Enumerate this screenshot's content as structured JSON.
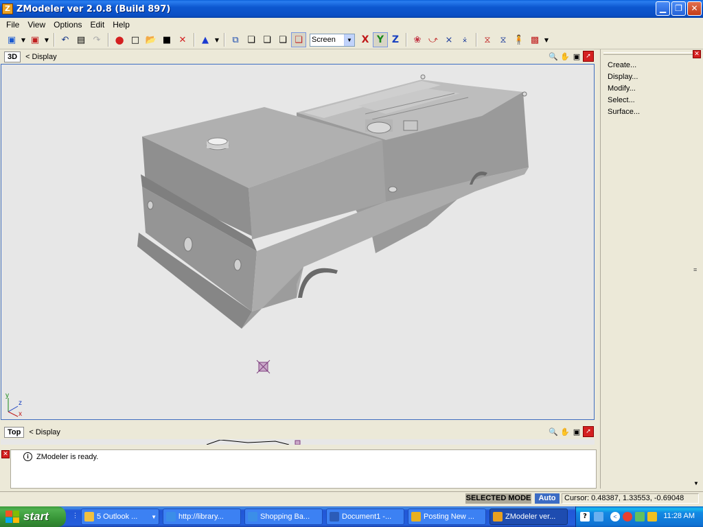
{
  "window": {
    "title": "ZModeler ver 2.0.8 (Build 897)",
    "icon_letter": "Z",
    "minimize_icon": "minimize-icon",
    "maximize_icon": "restore-icon",
    "close_icon": "close-icon"
  },
  "menu": {
    "items": [
      {
        "label": "File"
      },
      {
        "label": "View"
      },
      {
        "label": "Options"
      },
      {
        "label": "Edit"
      },
      {
        "label": "Help"
      }
    ]
  },
  "toolbar": {
    "view_select_value": "Screen",
    "axis_x": "X",
    "axis_y": "Y",
    "axis_z": "Z",
    "axis_colors": {
      "x": "#c01818",
      "y": "#1a8a1a",
      "z": "#1840c0"
    }
  },
  "viewport3d": {
    "label": "3D",
    "mode": "< Display",
    "axis_y": "y",
    "axis_z": "z",
    "axis_x": "x"
  },
  "viewport_top": {
    "label": "Top",
    "mode": "< Display"
  },
  "right_panel": {
    "items": [
      "Create...",
      "Display...",
      "Modify...",
      "Select...",
      "Surface..."
    ]
  },
  "log": {
    "message": "ZModeler is ready."
  },
  "status": {
    "mode": "SELECTED MODE",
    "auto": "Auto",
    "cursor": "Cursor: 0.48387, 1.33553, -0.69048"
  },
  "taskbar": {
    "start": "start",
    "tasks": [
      {
        "label": "5 Outlook ...",
        "icon_color": "#f0c040"
      },
      {
        "label": "http://library...",
        "icon_color": "#3b8ee8"
      },
      {
        "label": "Shopping Ba...",
        "icon_color": "#3b8ee8"
      },
      {
        "label": "Document1 -...",
        "icon_color": "#2b5cb8"
      },
      {
        "label": "Posting New ...",
        "icon_color": "#e8b020"
      },
      {
        "label": "ZModeler ver...",
        "icon_color": "#e8a020"
      }
    ],
    "clock": "11:28 AM"
  }
}
